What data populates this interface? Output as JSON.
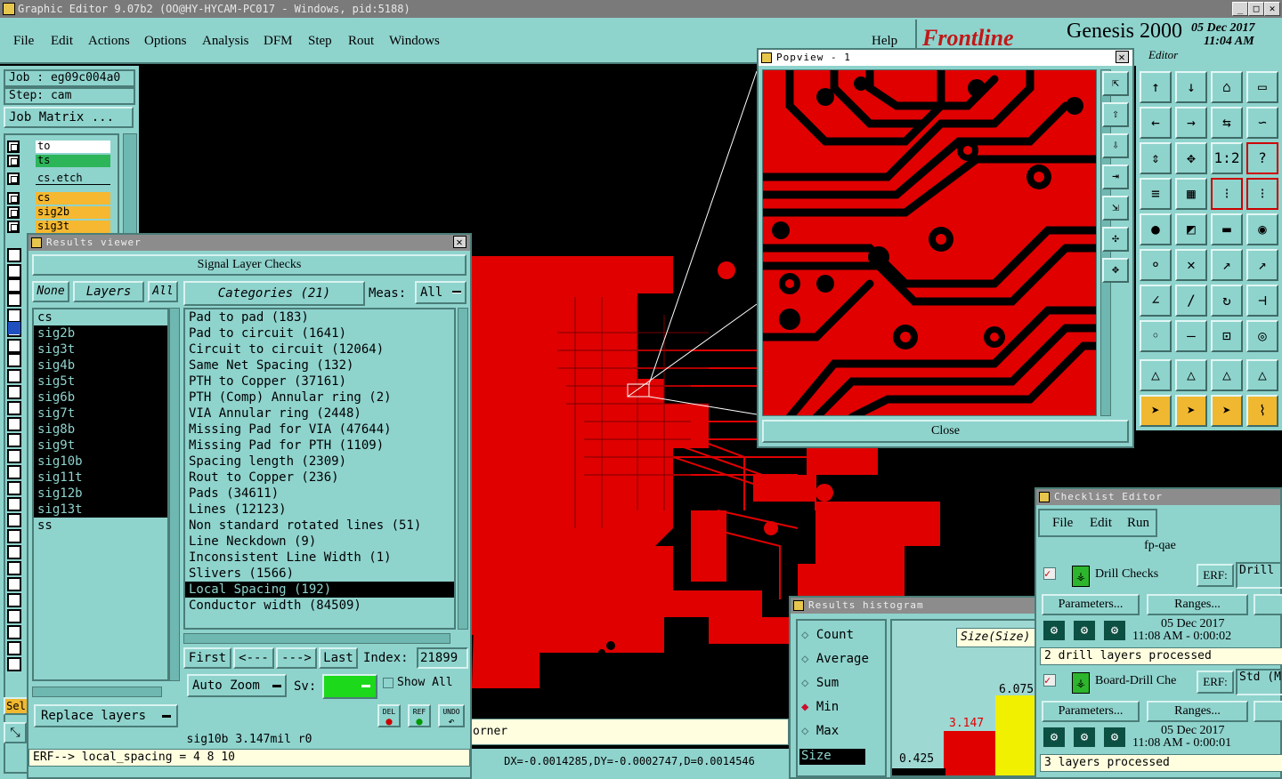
{
  "window": {
    "title": "Graphic Editor 9.07b2 (OO@HY-HYCAM-PC017 - Windows, pid:5188)",
    "buttons": [
      "_",
      "□",
      "✕"
    ]
  },
  "menubar": {
    "items": [
      "File",
      "Edit",
      "Actions",
      "Options",
      "Analysis",
      "DFM",
      "Step",
      "Rout",
      "Windows"
    ],
    "help": "Help"
  },
  "brand": {
    "logo": "Frontline",
    "product": "Genesis 2000",
    "date": "05 Dec 2017",
    "time": "11:04 AM",
    "subtitle": "Editor"
  },
  "left_panel": {
    "job": "Job : eg09c004a0",
    "step": "Step: cam",
    "job_matrix": "Job Matrix ...",
    "layers": [
      {
        "name": "to",
        "color": "#ffffff"
      },
      {
        "name": "ts",
        "color": "#2db55a"
      },
      {
        "name": "cs.etch",
        "color": "#8fd3cd"
      },
      {
        "name": "cs",
        "color": "#f5b830"
      },
      {
        "name": "sig2b",
        "color": "#f5b830"
      },
      {
        "name": "sig3t",
        "color": "#f5b830"
      }
    ],
    "sel_label": "Sel"
  },
  "results_viewer": {
    "title": "Results viewer",
    "header": "Signal Layer Checks",
    "none_btn": "None",
    "layers_label": "Layers",
    "all_btn": "All",
    "categories_label": "Categories (21)",
    "meas_label": "Meas:",
    "meas_value": "All",
    "layers": [
      "cs",
      "sig2b",
      "sig3t",
      "sig4b",
      "sig5t",
      "sig6b",
      "sig7t",
      "sig8b",
      "sig9t",
      "sig10b",
      "sig11t",
      "sig12b",
      "sig13t",
      "ss"
    ],
    "categories": [
      "Pad to pad (183)",
      "Pad to circuit (1641)",
      "Circuit to circuit (12064)",
      "Same Net Spacing (132)",
      "PTH to Copper (37161)",
      "PTH (Comp) Annular ring (2)",
      "VIA Annular ring (2448)",
      "Missing Pad for VIA (47644)",
      "Missing Pad for PTH (1109)",
      "Spacing length (2309)",
      "Rout to Copper (236)",
      "Pads (34611)",
      "Lines (12123)",
      "Non standard rotated lines (51)",
      "Line Neckdown (9)",
      "Inconsistent Line Width (1)",
      "Slivers (1566)",
      "Local Spacing (192)",
      "Conductor width (84509)"
    ],
    "selected_category": "Local Spacing (192)",
    "nav": {
      "first": "First",
      "prev": "<---",
      "next": "--->",
      "last": "Last",
      "index_label": "Index:",
      "index_value": "21899"
    },
    "auto_zoom": "Auto Zoom",
    "sv_label": "Sv:",
    "show_all": "Show All",
    "replace_layers": "Replace layers",
    "icons": [
      "DEL",
      "REF",
      "UNDO"
    ],
    "status": "sig10b  3.147mil  r0",
    "erf": "ERF--> local_spacing = 4 8 10"
  },
  "canvas": {
    "corner_text": "orner",
    "coords": "DX=-0.0014285,DY=-0.0002747,D=0.0014546"
  },
  "popview": {
    "title": "Popview - 1",
    "close": "Close"
  },
  "histogram": {
    "title": "Results histogram",
    "options": [
      "Count",
      "Average",
      "Sum",
      "Min",
      "Max"
    ],
    "selected": "Min",
    "size_field": "Size",
    "size_label": "Size(Size)",
    "values": [
      "0.425",
      "3.147",
      "6.075"
    ]
  },
  "checklist": {
    "title": "Checklist Editor",
    "menu": [
      "File",
      "Edit",
      "Run"
    ],
    "name": "fp-qae",
    "sections": [
      {
        "name": "Drill Checks",
        "erf_label": "ERF:",
        "erf_value": "Drill",
        "params": "Parameters...",
        "ranges": "Ranges...",
        "date": "05 Dec 2017",
        "time": "11:08 AM - 0:00:02",
        "status": "2 drill layers processed"
      },
      {
        "name": "Board-Drill Che",
        "erf_label": "ERF:",
        "erf_value": "Std (M",
        "params": "Parameters...",
        "ranges": "Ranges...",
        "date": "05 Dec 2017",
        "time": "11:08 AM - 0:00:01",
        "status": "3 layers processed"
      }
    ]
  },
  "toolbox": {
    "rows": [
      [
        "↑",
        "↓",
        "⌂",
        "▭"
      ],
      [
        "←",
        "→",
        "⇆",
        "∽"
      ],
      [
        "⇕",
        "✥",
        "1:2",
        "?"
      ],
      [
        "≡",
        "▦",
        "⁝",
        "⁝"
      ],
      [
        "●",
        "◩",
        "▬",
        "◉"
      ],
      [
        "⚬",
        "✕",
        "↗",
        "↗"
      ],
      [
        "∠",
        "/",
        "↻",
        "⊣"
      ],
      [
        "◦",
        "—",
        "⊡",
        "◎"
      ],
      [
        "△",
        "△",
        "△",
        "△"
      ],
      [
        "➤",
        "➤",
        "➤",
        "⌇"
      ]
    ],
    "side": [
      "⇱",
      "⇧",
      "⇩",
      "⇥",
      "⇲",
      "✣",
      "✥"
    ]
  }
}
